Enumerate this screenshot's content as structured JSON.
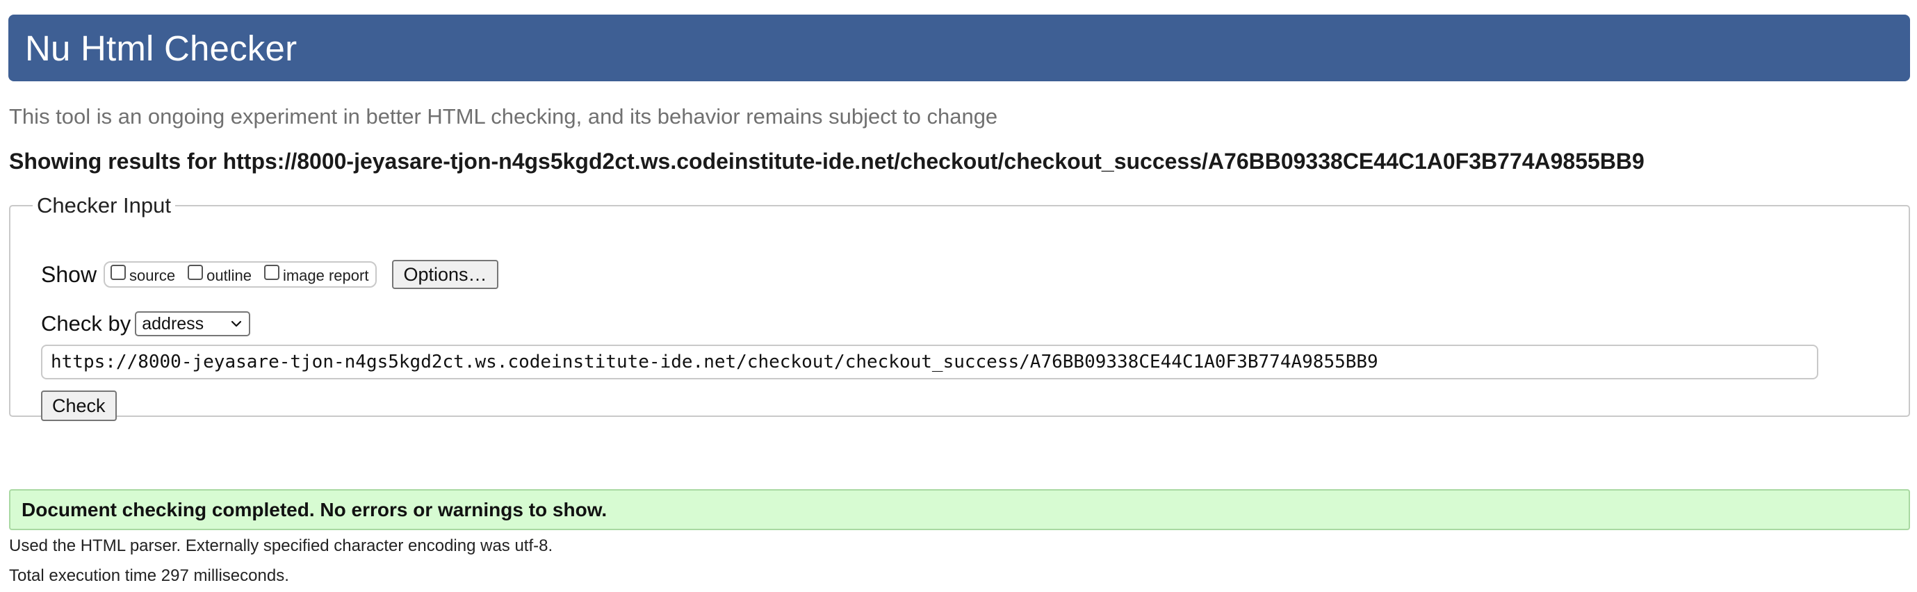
{
  "header": {
    "title": "Nu Html Checker"
  },
  "subtitle": "This tool is an ongoing experiment in better HTML checking, and its behavior remains subject to change",
  "results_heading": "Showing results for https://8000-jeyasare-tjon-n4gs5kgd2ct.ws.codeinstitute-ide.net/checkout/checkout_success/A76BB09338CE44C1A0F3B774A9855BB9",
  "checker_input": {
    "legend": "Checker Input",
    "show_label": "Show",
    "show_options": [
      {
        "label": "source",
        "checked": false
      },
      {
        "label": "outline",
        "checked": false
      },
      {
        "label": "image report",
        "checked": false
      }
    ],
    "options_button": "Options…",
    "check_by_label": "Check by",
    "check_by_selected": "address",
    "url_value": "https://8000-jeyasare-tjon-n4gs5kgd2ct.ws.codeinstitute-ide.net/checkout/checkout_success/A76BB09338CE44C1A0F3B774A9855BB9",
    "check_button": "Check"
  },
  "result": {
    "success_message": "Document checking completed. No errors or warnings to show.",
    "parser_info": "Used the HTML parser. Externally specified character encoding was utf-8.",
    "execution_time": "Total execution time 297 milliseconds."
  },
  "colors": {
    "header_bg": "#3e5f94",
    "success_bg": "#d7fbd2",
    "success_border": "#a9d9a2",
    "subtitle_text": "#707070"
  }
}
